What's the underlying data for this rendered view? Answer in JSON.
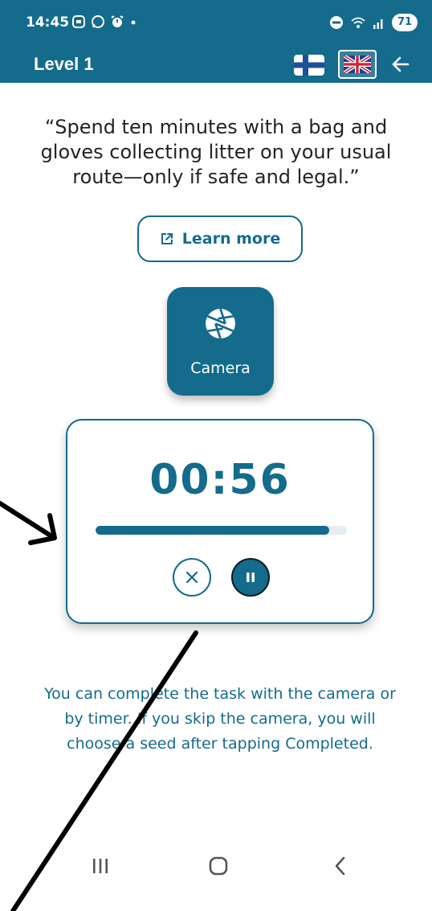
{
  "status_bar": {
    "time": "14:45",
    "battery": "71"
  },
  "app_bar": {
    "title": "Level 1",
    "flags": [
      "finland-flag",
      "uk-flag"
    ],
    "back_icon": "arrow-left-icon"
  },
  "task": {
    "quote": "“Spend ten minutes with a bag and gloves collecting litter on your usual route—only if safe and legal.”"
  },
  "learn_more": {
    "label": "Learn more",
    "icon": "external-link-icon"
  },
  "camera": {
    "label": "Camera",
    "icon": "camera-aperture-icon"
  },
  "timer": {
    "display": "00:56",
    "progress_fraction": 0.93,
    "cancel_icon": "close-icon",
    "pause_icon": "pause-icon"
  },
  "info": {
    "text": "You can complete the task with the camera or by timer. If you skip the camera, you will choose a seed after tapping Completed."
  },
  "nav_bar": {
    "icons": [
      "recent-apps-icon",
      "home-icon",
      "back-icon"
    ]
  },
  "colors": {
    "primary": "#146b8c",
    "text_dark": "#1f2326",
    "track": "#e6ecef",
    "annotation": "#000000"
  }
}
